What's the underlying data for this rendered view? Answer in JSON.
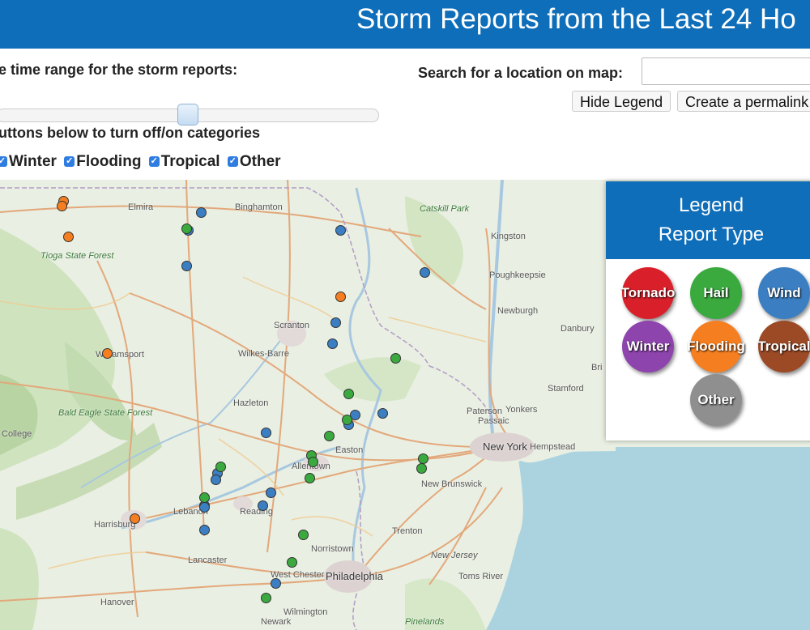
{
  "header": {
    "title": "Storm Reports from the Last 24 Ho"
  },
  "controls": {
    "time_range_label": "e time range for the storm reports:",
    "categories_label": "uttons below to turn off/on categories",
    "search_label": "Search for a location on map:",
    "search_value": "",
    "hide_legend": "Hide Legend",
    "permalink": "Create a permalink"
  },
  "categories": [
    {
      "label": "Winter",
      "checked": true
    },
    {
      "label": "Flooding",
      "checked": true
    },
    {
      "label": "Tropical",
      "checked": true
    },
    {
      "label": "Other",
      "checked": true
    }
  ],
  "legend": {
    "title": "Legend",
    "subtitle": "Report Type",
    "types": [
      {
        "label": "Tornado",
        "color": "#d9202a"
      },
      {
        "label": "Hail",
        "color": "#3aaa3f"
      },
      {
        "label": "Wind",
        "color": "#3b7fc2"
      },
      {
        "label": "Winter",
        "color": "#8e44ad"
      },
      {
        "label": "Flooding",
        "color": "#f57f20"
      },
      {
        "label": "Tropical",
        "color": "#9b4a25"
      },
      {
        "label": "Other",
        "color": "#8f8f8f"
      }
    ]
  },
  "map_labels": [
    "Elmira",
    "Binghamton",
    "Catskill Park",
    "Kingston",
    "Poughkeepsie",
    "Newburgh",
    "Danbury",
    "Tioga State Forest",
    "Williamsport",
    "Scranton",
    "Wilkes-Barre",
    "Hazleton",
    "Bald Eagle State Forest",
    "Stamford",
    "Paterson",
    "Yonkers",
    "Passaic",
    "New York",
    "Hempstead",
    "Easton",
    "Allentown",
    "New Brunswick",
    "Lebanon",
    "Reading",
    "Harrisburg",
    "Trenton",
    "Norristown",
    "New Jersey",
    "Lancaster",
    "West Chester",
    "Philadelphia",
    "Toms River",
    "Hanover",
    "Wilmington",
    "Newark",
    "Pinelands",
    "College",
    "Bri"
  ]
}
